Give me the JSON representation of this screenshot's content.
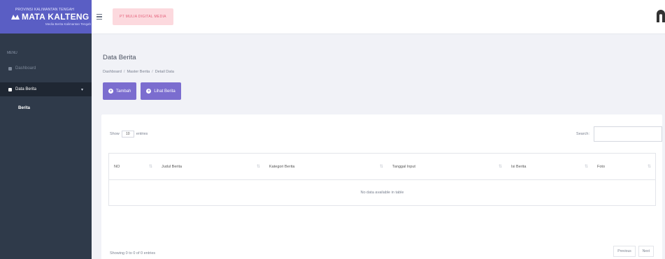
{
  "brand": {
    "top_text": "PROVINSI KALIMANTAN TENGAH",
    "main_text": "MATA KALTENG",
    "sub_text": "Media Berita Kalimantan Tengah"
  },
  "sidebar": {
    "heading": "MENU",
    "items": [
      {
        "label": "Dashboard",
        "icon": "dashboard-icon"
      },
      {
        "label": "Data Berita",
        "icon": "news-icon"
      }
    ],
    "submenu": [
      {
        "label": "Berita"
      }
    ]
  },
  "header": {
    "org_label": "PT MULIA DIGITAL MEDIA",
    "user_icon": "user-icon"
  },
  "page": {
    "title": "Data Berita",
    "breadcrumb": [
      "Dashboard",
      "Master Berita",
      "Detail Data"
    ],
    "breadcrumb_sep": "/"
  },
  "actions": {
    "add_label": "Tambah",
    "view_label": "Lihat Berita"
  },
  "table_controls": {
    "show_label": "Show",
    "entries_value": "10",
    "entries_label": "entries",
    "search_label": "Search:"
  },
  "table": {
    "columns": [
      "NO",
      "Judul Berita",
      "Kategori Berita",
      "Tanggal Input",
      "Isi Berita",
      "Foto"
    ],
    "empty_text": "No data available in table"
  },
  "footer": {
    "info": "Showing 0 to 0 of 0 entries",
    "prev": "Previous",
    "next": "Next"
  },
  "colors": {
    "sidebar_bg": "#2f3a4a",
    "brand_bg": "#5a5ec4",
    "accent": "#7b6dcf",
    "badge_bg": "#fcd9de",
    "badge_text": "#e4607a"
  }
}
